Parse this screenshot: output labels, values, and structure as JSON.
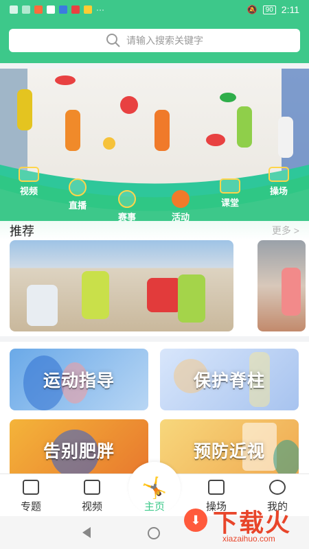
{
  "status_bar": {
    "battery": "90",
    "time": "2:11",
    "more": "···"
  },
  "search": {
    "placeholder": "请输入搜索关键字"
  },
  "features": [
    {
      "label": "视频",
      "icon": "video-icon"
    },
    {
      "label": "直播",
      "icon": "live-icon"
    },
    {
      "label": "赛事",
      "icon": "trophy-icon"
    },
    {
      "label": "活动",
      "icon": "basketball-icon"
    },
    {
      "label": "课堂",
      "icon": "classroom-icon"
    },
    {
      "label": "操场",
      "icon": "playground-icon"
    }
  ],
  "recommend": {
    "title": "推荐",
    "more": "更多 >"
  },
  "categories": [
    {
      "label": "运动指导"
    },
    {
      "label": "保护脊柱"
    },
    {
      "label": "告别肥胖"
    },
    {
      "label": "预防近视"
    }
  ],
  "bottom_nav": [
    {
      "label": "专题",
      "icon": "topic-icon"
    },
    {
      "label": "视频",
      "icon": "video-icon"
    },
    {
      "label": "主页",
      "icon": "home-logo-icon"
    },
    {
      "label": "操场",
      "icon": "playground-icon"
    },
    {
      "label": "我的",
      "icon": "profile-icon"
    }
  ],
  "watermark": {
    "main": "下载火",
    "sub": "xiazaihuo.com"
  },
  "colors": {
    "primary": "#3dc88a",
    "watermark": "#e8452a"
  }
}
